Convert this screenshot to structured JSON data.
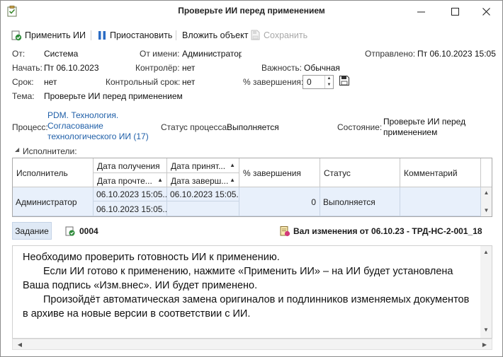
{
  "window": {
    "title": "Проверьте ИИ перед применением"
  },
  "toolbar": {
    "apply_label": "Применить ИИ",
    "pause_label": "Приостановить",
    "attach_label": "Вложить объект",
    "save_label": "Сохранить"
  },
  "fields": {
    "from_label": "От:",
    "from_value": "Система",
    "on_behalf_label": "От имени:",
    "on_behalf_value": "Администратор",
    "sent_label": "Отправлено:",
    "sent_value": "Пт 06.10.2023 15:05",
    "start_label": "Начать:",
    "start_value": "Пт 06.10.2023",
    "controller_label": "Контролёр:",
    "controller_value": "нет",
    "importance_label": "Важность:",
    "importance_value": "Обычная",
    "due_label": "Срок:",
    "due_value": "нет",
    "control_due_label": "Контрольный срок:",
    "control_due_value": "нет",
    "completion_label": "% завершения:",
    "completion_value": "0",
    "subject_label": "Тема:",
    "subject_value": "Проверьте ИИ перед применением",
    "process_label": "Процесс:",
    "process_line1": "PDM. Технология.",
    "process_line2": "Согласование",
    "process_line3": "технологического ИИ (17)",
    "process_status_label": "Статус процесса:",
    "process_status_value": "Выполняется",
    "state_label": "Состояние:",
    "state_line1": "Проверьте ИИ перед",
    "state_line2": "применением"
  },
  "executors": {
    "section_label": "Исполнители:",
    "columns": {
      "executor": "Исполнитель",
      "received": "Дата получения",
      "accepted": "Дата принят...",
      "read": "Дата прочте...",
      "completed": "Дата заверш...",
      "percent": "% завершения",
      "status": "Статус",
      "comment": "Комментарий"
    },
    "row": {
      "executor": "Администратор",
      "received": "06.10.2023 15:05...",
      "accepted": "06.10.2023 15:05...",
      "read": "06.10.2023 15:05...",
      "completed": "",
      "percent": "0",
      "status": "Выполняется",
      "comment": ""
    }
  },
  "task": {
    "tab_label": "Задание",
    "object_number": "0004",
    "attachment_label": "Вал изменения от 06.10.23 - ТРД-НС-2-001_18"
  },
  "message": {
    "line1": "Необходимо проверить готовность ИИ к применению.",
    "line2": "Если ИИ готово к применению, нажмите «Применить ИИ» – на ИИ будет установлена",
    "line3": "Ваша подпись «Изм.внес». ИИ будет применено.",
    "line4": "Произойдёт автоматическая замена оригиналов и подлинников изменяемых документов",
    "line5": "в архиве на новые версии в соответствии с ИИ."
  },
  "colors": {
    "link": "#1f5fa8",
    "selected_row": "#e8f0fb",
    "tab_active": "#dfe9f5",
    "apply_icon_green": "#2e8b3a",
    "pause_icon_blue": "#2b6cc4"
  }
}
